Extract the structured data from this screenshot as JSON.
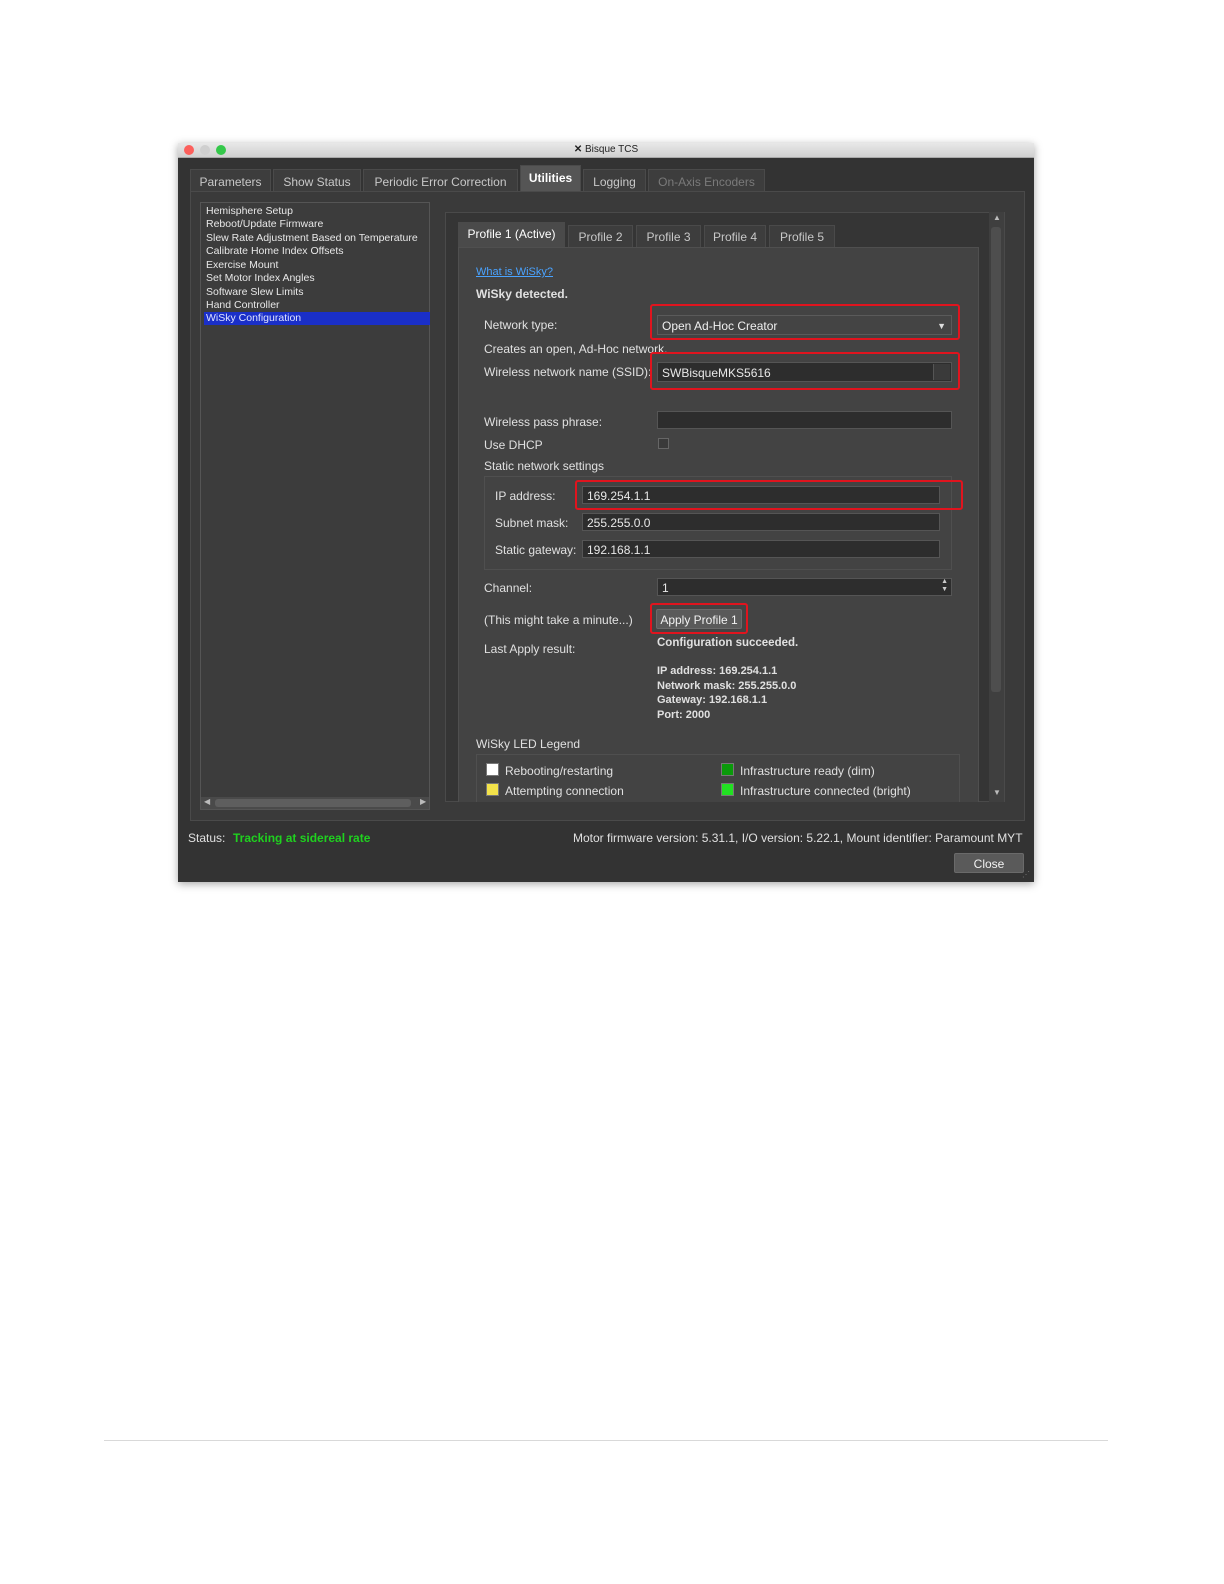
{
  "window": {
    "title": "Bisque TCS"
  },
  "tabs": [
    {
      "label": "Parameters"
    },
    {
      "label": "Show Status"
    },
    {
      "label": "Periodic Error Correction"
    },
    {
      "label": "Utilities"
    },
    {
      "label": "Logging"
    },
    {
      "label": "On-Axis Encoders"
    }
  ],
  "utilities_list": [
    "Hemisphere Setup",
    "Reboot/Update Firmware",
    "Slew Rate Adjustment Based on Temperature",
    "Calibrate Home Index Offsets",
    "Exercise Mount",
    "Set Motor Index Angles",
    "Software Slew Limits",
    "Hand Controller",
    "WiSky Configuration"
  ],
  "profile_tabs": [
    "Profile 1 (Active)",
    "Profile 2",
    "Profile 3",
    "Profile 4",
    "Profile 5"
  ],
  "wisky": {
    "what_is_link": "What is WiSky?",
    "detected": "WiSky detected.",
    "network_type_label": "Network type:",
    "network_type_value": "Open Ad-Hoc Creator",
    "network_desc": "Creates an open, Ad-Hoc network.",
    "ssid_label": "Wireless network name (SSID):",
    "ssid_value": "SWBisqueMKS5616",
    "pass_label": "Wireless pass phrase:",
    "pass_value": "",
    "dhcp_label": "Use DHCP",
    "static_label": "Static network settings",
    "ip_label": "IP address:",
    "ip_value": "169.254.1.1",
    "subnet_label": "Subnet mask:",
    "subnet_value": "255.255.0.0",
    "gateway_label": "Static gateway:",
    "gateway_value": "192.168.1.1",
    "channel_label": "Channel:",
    "channel_value": "1",
    "minute_note": "(This might take a minute...)",
    "apply_button": "Apply Profile 1",
    "last_apply_label": "Last Apply result:",
    "result_title": "Configuration succeeded.",
    "result_lines": [
      "IP address: 169.254.1.1",
      "Network mask: 255.255.0.0",
      "Gateway: 192.168.1.1",
      "Port: 2000"
    ],
    "legend_title": "WiSky LED Legend",
    "legend": [
      {
        "label": "Rebooting/restarting",
        "color": "#ffffff"
      },
      {
        "label": "Infrastructure ready (dim)",
        "color": "#0a9a0a"
      },
      {
        "label": "Attempting connection",
        "color": "#f2e24a"
      },
      {
        "label": "Infrastructure connected (bright)",
        "color": "#22e022"
      }
    ]
  },
  "status": {
    "label": "Status:",
    "value": "Tracking at sidereal rate",
    "firmware": "Motor firmware version: 5.31.1, I/O version: 5.22.1, Mount identifier: Paramount MYT"
  },
  "close_button": "Close"
}
